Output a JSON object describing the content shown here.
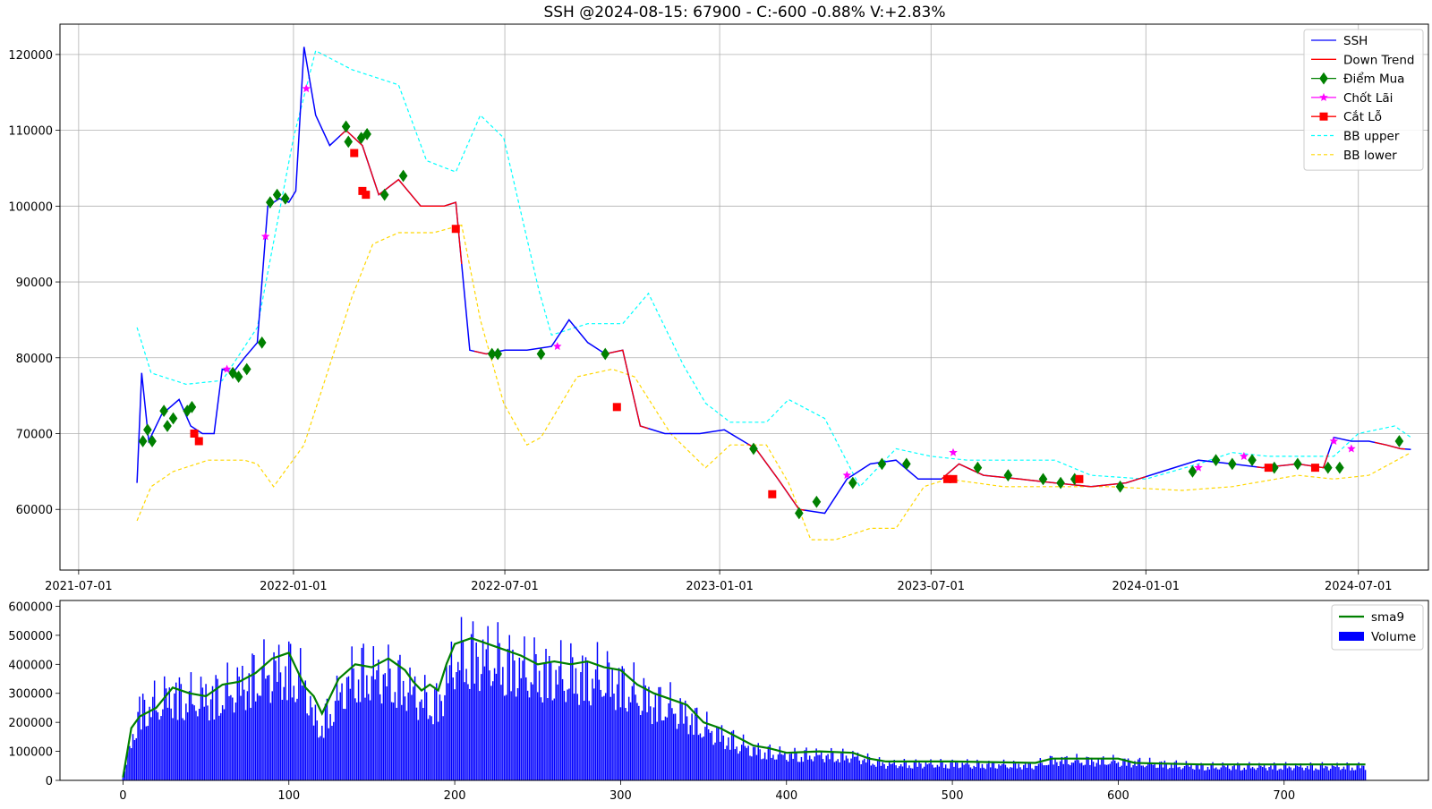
{
  "title": "SSH @2024-08-15: 67900 - C:-600 -0.88% V:+2.83%",
  "chart_data": [
    {
      "type": "line",
      "title": "SSH @2024-08-15: 67900 - C:-600 -0.88% V:+2.83%",
      "x_axis": {
        "type": "date",
        "range": [
          "2021-06-15",
          "2024-08-30"
        ],
        "ticks": [
          "2021-07-01",
          "2022-01-01",
          "2022-07-01",
          "2023-01-01",
          "2023-07-01",
          "2024-01-01",
          "2024-07-01"
        ]
      },
      "y_axis": {
        "range": [
          52000,
          124000
        ],
        "ticks": [
          60000,
          70000,
          80000,
          90000,
          100000,
          110000,
          120000
        ]
      },
      "grid": true,
      "legend_position": "top-right",
      "legend": [
        "SSH",
        "Down Trend",
        "Điểm Mua",
        "Chốt Lãi",
        "Cắt Lỗ",
        "BB upper",
        "BB lower"
      ],
      "colors": {
        "ssh": "#0000ff",
        "down_trend": "#ff0000",
        "diem_mua": "#008000",
        "chot_lai": "#ff00ff",
        "cat_lo": "#ff0000",
        "bb_upper": "#00ffff",
        "bb_lower": "#ffd700"
      },
      "series": [
        {
          "name": "SSH",
          "style": "solid",
          "x": [
            "2021-08-20",
            "2021-08-24",
            "2021-08-30",
            "2021-09-10",
            "2021-09-25",
            "2021-10-05",
            "2021-10-15",
            "2021-10-25",
            "2021-11-01",
            "2021-11-10",
            "2021-11-20",
            "2021-12-01",
            "2021-12-10",
            "2021-12-20",
            "2021-12-28",
            "2022-01-03",
            "2022-01-10",
            "2022-01-20",
            "2022-02-01",
            "2022-02-15",
            "2022-03-01",
            "2022-03-15",
            "2022-04-01",
            "2022-04-20",
            "2022-05-10",
            "2022-05-20",
            "2022-06-01",
            "2022-06-15",
            "2022-07-01",
            "2022-07-20",
            "2022-08-10",
            "2022-08-25",
            "2022-09-10",
            "2022-09-25",
            "2022-10-10",
            "2022-10-25",
            "2022-11-15",
            "2022-12-15",
            "2023-01-05",
            "2023-02-01",
            "2023-02-20",
            "2023-03-10",
            "2023-04-01",
            "2023-04-20",
            "2023-05-10",
            "2023-06-01",
            "2023-06-20",
            "2023-07-10",
            "2023-07-25",
            "2023-08-15",
            "2023-09-15",
            "2023-10-15",
            "2023-11-15",
            "2023-12-15",
            "2024-01-15",
            "2024-02-15",
            "2024-03-15",
            "2024-04-10",
            "2024-05-10",
            "2024-06-01",
            "2024-06-10",
            "2024-06-25",
            "2024-07-10",
            "2024-07-25",
            "2024-08-06",
            "2024-08-15"
          ],
          "y": [
            63500,
            78000,
            69000,
            72500,
            74500,
            71000,
            70000,
            70000,
            78500,
            78000,
            80000,
            82000,
            100000,
            101000,
            100500,
            102000,
            121000,
            112000,
            108000,
            110000,
            108000,
            101500,
            103500,
            100000,
            100000,
            100500,
            81000,
            80500,
            81000,
            81000,
            81500,
            85000,
            82000,
            80500,
            81000,
            71000,
            70000,
            70000,
            70500,
            68000,
            64000,
            60000,
            59500,
            64000,
            66000,
            66500,
            64000,
            64000,
            66000,
            64500,
            64000,
            63500,
            63000,
            63500,
            65000,
            66500,
            66000,
            65500,
            66000,
            65500,
            69500,
            69000,
            69000,
            68500,
            68000,
            67900
          ]
        },
        {
          "name": "BB upper",
          "style": "dashed",
          "x": [
            "2021-08-20",
            "2021-09-01",
            "2021-10-01",
            "2021-11-01",
            "2021-12-01",
            "2022-01-01",
            "2022-01-20",
            "2022-02-20",
            "2022-04-01",
            "2022-04-25",
            "2022-05-20",
            "2022-06-10",
            "2022-06-30",
            "2022-07-30",
            "2022-08-10",
            "2022-09-10",
            "2022-10-10",
            "2022-11-01",
            "2022-12-01",
            "2022-12-20",
            "2023-01-10",
            "2023-02-10",
            "2023-03-01",
            "2023-04-01",
            "2023-05-01",
            "2023-06-01",
            "2023-07-01",
            "2023-08-01",
            "2023-09-01",
            "2023-10-15",
            "2023-11-15",
            "2024-01-01",
            "2024-02-15",
            "2024-03-15",
            "2024-04-15",
            "2024-05-15",
            "2024-06-10",
            "2024-07-01",
            "2024-08-01",
            "2024-08-15"
          ],
          "y": [
            84000,
            78000,
            76500,
            77000,
            84000,
            109000,
            120500,
            118000,
            116000,
            106000,
            104500,
            112000,
            109000,
            89000,
            83000,
            84500,
            84500,
            88500,
            79000,
            74000,
            71500,
            71500,
            74500,
            72000,
            63000,
            68000,
            67000,
            66500,
            66500,
            66500,
            64500,
            64000,
            66000,
            67500,
            67000,
            67000,
            67000,
            70000,
            71000,
            69500
          ]
        },
        {
          "name": "BB lower",
          "style": "dashed",
          "x": [
            "2021-08-20",
            "2021-09-01",
            "2021-09-20",
            "2021-10-20",
            "2021-11-20",
            "2021-12-01",
            "2021-12-15",
            "2022-01-10",
            "2022-02-01",
            "2022-02-20",
            "2022-03-10",
            "2022-04-01",
            "2022-05-01",
            "2022-05-25",
            "2022-06-10",
            "2022-06-30",
            "2022-07-20",
            "2022-08-01",
            "2022-09-01",
            "2022-10-01",
            "2022-10-20",
            "2022-11-20",
            "2022-12-20",
            "2023-01-10",
            "2023-02-10",
            "2023-03-01",
            "2023-03-20",
            "2023-04-10",
            "2023-05-10",
            "2023-06-01",
            "2023-06-25",
            "2023-07-15",
            "2023-09-01",
            "2023-12-01",
            "2024-02-01",
            "2024-03-15",
            "2024-05-10",
            "2024-06-10",
            "2024-07-10",
            "2024-08-15"
          ],
          "y": [
            58500,
            63000,
            65000,
            66500,
            66500,
            66000,
            63000,
            68500,
            79000,
            88000,
            95000,
            96500,
            96500,
            97500,
            85000,
            74000,
            68500,
            69500,
            77500,
            78500,
            77500,
            70000,
            65500,
            68500,
            68500,
            63500,
            56000,
            56000,
            57500,
            57500,
            63000,
            64000,
            63000,
            63000,
            62500,
            63000,
            64500,
            64000,
            64500,
            67500
          ]
        }
      ],
      "markers": {
        "diem_mua": {
          "name": "Điểm Mua",
          "x": [
            "2021-08-25",
            "2021-08-29",
            "2021-09-02",
            "2021-09-12",
            "2021-09-15",
            "2021-09-20",
            "2021-10-02",
            "2021-10-06",
            "2021-11-10",
            "2021-11-15",
            "2021-11-22",
            "2021-12-05",
            "2021-12-12",
            "2021-12-18",
            "2021-12-25",
            "2022-02-15",
            "2022-02-17",
            "2022-02-28",
            "2022-03-05",
            "2022-03-20",
            "2022-04-05",
            "2022-06-20",
            "2022-06-25",
            "2022-08-01",
            "2022-09-25",
            "2023-01-30",
            "2023-03-10",
            "2023-03-25",
            "2023-04-25",
            "2023-05-20",
            "2023-06-10",
            "2023-08-10",
            "2023-09-05",
            "2023-10-05",
            "2023-10-20",
            "2023-11-01",
            "2023-12-10",
            "2024-02-10",
            "2024-03-01",
            "2024-03-15",
            "2024-04-01",
            "2024-04-20",
            "2024-05-10",
            "2024-06-05",
            "2024-06-15",
            "2024-08-05"
          ],
          "y": [
            69000,
            70500,
            69000,
            73000,
            71000,
            72000,
            73000,
            73500,
            78000,
            77500,
            78500,
            82000,
            100500,
            101500,
            101000,
            110500,
            108500,
            109000,
            109500,
            101500,
            104000,
            80500,
            80500,
            80500,
            80500,
            68000,
            59500,
            61000,
            63500,
            66000,
            66000,
            65500,
            64500,
            64000,
            63500,
            64000,
            63000,
            65000,
            66500,
            66000,
            66500,
            65500,
            66000,
            65500,
            65500,
            69000
          ]
        },
        "chot_lai": {
          "name": "Chốt Lãi",
          "x": [
            "2021-11-05",
            "2021-12-08",
            "2022-01-12",
            "2022-08-15",
            "2023-04-20",
            "2023-07-20",
            "2024-02-15",
            "2024-03-25",
            "2024-06-10",
            "2024-06-25"
          ],
          "y": [
            78500,
            96000,
            115500,
            81500,
            64500,
            67500,
            65500,
            67000,
            69000,
            68000
          ]
        },
        "cat_lo": {
          "name": "Cắt Lỗ",
          "x": [
            "2021-10-08",
            "2021-10-12",
            "2022-02-22",
            "2022-03-01",
            "2022-03-04",
            "2022-05-20",
            "2022-10-05",
            "2023-02-15",
            "2023-07-15",
            "2023-07-20",
            "2023-11-05",
            "2024-04-15",
            "2024-05-25"
          ],
          "y": [
            70000,
            69000,
            107000,
            102000,
            101500,
            97000,
            73500,
            62000,
            64000,
            64000,
            64000,
            65500,
            65500
          ]
        }
      },
      "down_trend_ranges": [
        [
          "2022-02-10",
          "2022-05-25"
        ],
        [
          "2022-06-05",
          "2022-06-20"
        ],
        [
          "2022-09-25",
          "2022-11-01"
        ],
        [
          "2023-01-25",
          "2023-03-15"
        ],
        [
          "2023-07-10",
          "2024-01-01"
        ],
        [
          "2024-04-05",
          "2024-06-05"
        ],
        [
          "2024-07-15",
          "2024-08-10"
        ]
      ]
    },
    {
      "type": "bar",
      "x_axis": {
        "range": [
          -38,
          787
        ],
        "ticks": [
          0,
          100,
          200,
          300,
          400,
          500,
          600,
          700
        ]
      },
      "y_axis": {
        "range": [
          0,
          620000
        ],
        "ticks": [
          0,
          100000,
          200000,
          300000,
          400000,
          500000,
          600000
        ]
      },
      "legend_position": "top-right",
      "legend": [
        "sma9",
        "Volume"
      ],
      "colors": {
        "volume": "#0000ff",
        "sma9": "#008000"
      },
      "series": [
        {
          "name": "sma9",
          "x": [
            0,
            5,
            10,
            20,
            30,
            40,
            50,
            60,
            70,
            80,
            90,
            100,
            105,
            110,
            115,
            120,
            125,
            130,
            140,
            150,
            160,
            170,
            175,
            180,
            185,
            190,
            195,
            200,
            210,
            220,
            230,
            240,
            250,
            260,
            270,
            280,
            290,
            300,
            310,
            320,
            330,
            340,
            350,
            360,
            370,
            380,
            390,
            400,
            420,
            440,
            450,
            460,
            480,
            500,
            550,
            560,
            600,
            610,
            650,
            700,
            749
          ],
          "y": [
            10000,
            180000,
            220000,
            250000,
            320000,
            300000,
            290000,
            330000,
            340000,
            370000,
            420000,
            440000,
            380000,
            320000,
            290000,
            230000,
            290000,
            350000,
            400000,
            390000,
            420000,
            380000,
            340000,
            310000,
            330000,
            310000,
            400000,
            470000,
            490000,
            470000,
            450000,
            430000,
            400000,
            410000,
            400000,
            410000,
            390000,
            380000,
            330000,
            300000,
            280000,
            260000,
            200000,
            180000,
            150000,
            120000,
            110000,
            95000,
            100000,
            95000,
            75000,
            65000,
            65000,
            65000,
            60000,
            75000,
            75000,
            60000,
            55000,
            55000,
            55000
          ]
        },
        {
          "name": "Volume",
          "x": [
            0,
            10,
            20,
            30,
            40,
            50,
            60,
            70,
            80,
            90,
            100,
            110,
            115,
            120,
            125,
            130,
            140,
            150,
            160,
            170,
            180,
            190,
            200,
            210,
            220,
            230,
            240,
            250,
            260,
            270,
            280,
            290,
            300,
            310,
            320,
            330,
            340,
            350,
            360,
            370,
            380,
            390,
            400,
            420,
            440,
            460,
            480,
            500,
            550,
            560,
            600,
            650,
            700,
            749
          ],
          "y": [
            15000,
            280000,
            300000,
            340000,
            320000,
            330000,
            340000,
            370000,
            410000,
            430000,
            440000,
            380000,
            240000,
            220000,
            280000,
            330000,
            430000,
            420000,
            410000,
            380000,
            320000,
            300000,
            480000,
            500000,
            480000,
            470000,
            440000,
            430000,
            420000,
            420000,
            410000,
            410000,
            380000,
            340000,
            310000,
            290000,
            260000,
            210000,
            180000,
            150000,
            120000,
            110000,
            100000,
            100000,
            95000,
            65000,
            65000,
            65000,
            60000,
            80000,
            75000,
            55000,
            55000,
            55000
          ]
        }
      ]
    }
  ]
}
